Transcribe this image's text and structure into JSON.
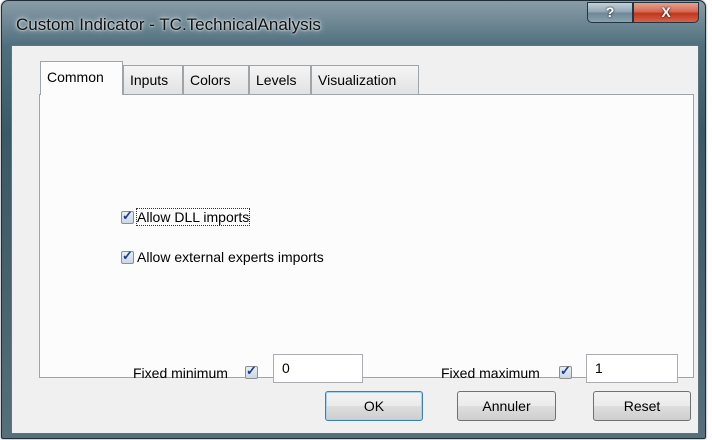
{
  "window": {
    "title": "Custom Indicator - TC.TechnicalAnalysis",
    "help_glyph": "?",
    "close_glyph": "X"
  },
  "tabs": [
    {
      "label": "Common",
      "active": true
    },
    {
      "label": "Inputs",
      "active": false
    },
    {
      "label": "Colors",
      "active": false
    },
    {
      "label": "Levels",
      "active": false
    },
    {
      "label": "Visualization",
      "active": false
    }
  ],
  "common": {
    "allow_dll": {
      "label": "Allow DLL imports",
      "checked": true
    },
    "allow_external": {
      "label": "Allow external experts imports",
      "checked": true
    },
    "fixed_min": {
      "label": "Fixed minimum",
      "checked": true,
      "value": "0"
    },
    "fixed_max": {
      "label": "Fixed maximum",
      "checked": true,
      "value": "1"
    }
  },
  "buttons": {
    "ok": "OK",
    "cancel": "Annuler",
    "reset": "Reset"
  }
}
